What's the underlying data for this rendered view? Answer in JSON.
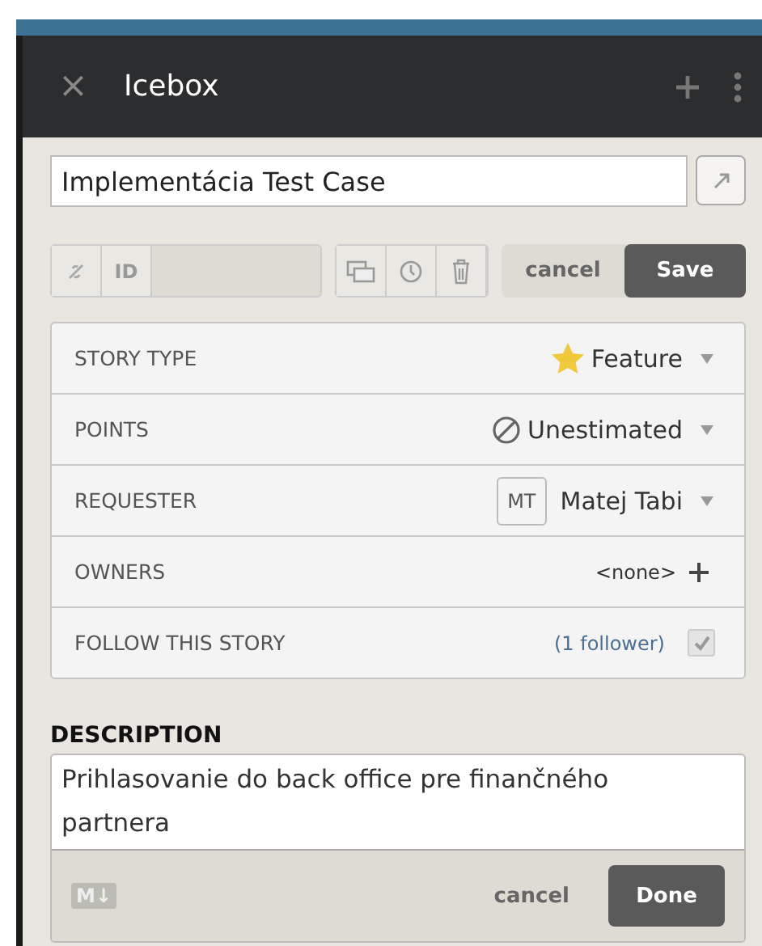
{
  "header": {
    "close": "×",
    "title": "Icebox"
  },
  "story": {
    "title": "Implementácia Test Case",
    "id_label": "ID",
    "cancel": "cancel",
    "save": "Save"
  },
  "fields": [
    {
      "kind": "type",
      "label": "STORY TYPE",
      "value": "Feature"
    },
    {
      "kind": "points",
      "label": "POINTS",
      "value": "Unestimated"
    },
    {
      "kind": "person",
      "label": "REQUESTER",
      "initials": "MT",
      "value": "Matej Tabi"
    },
    {
      "kind": "add",
      "label": "OWNERS",
      "value": "<none>"
    },
    {
      "kind": "follow",
      "label": "FOLLOW THIS STORY",
      "value": "(1 follower)",
      "checked": true
    }
  ],
  "description": {
    "label": "DESCRIPTION",
    "text": "Prihlasovanie do back office pre finančného partnera",
    "markdown": "M↓",
    "cancel": "cancel",
    "done": "Done"
  }
}
